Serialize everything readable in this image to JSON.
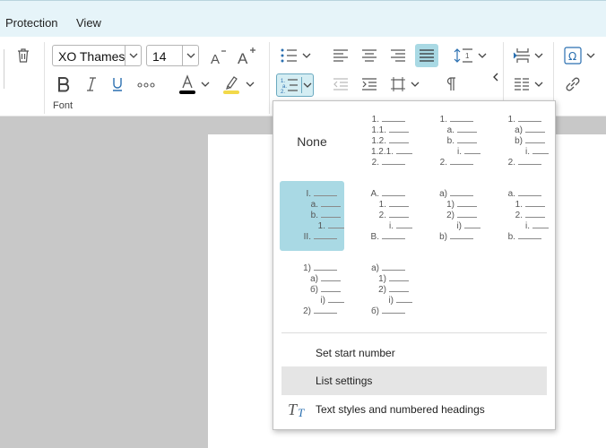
{
  "menubar": {
    "items": [
      "Protection",
      "View"
    ]
  },
  "ribbon": {
    "font_name": "XO Thames",
    "font_size": "14",
    "font_group_label": "Font",
    "font_color": "#000000",
    "highlight_color": "#f2d94a",
    "accent": "#a9d9e4"
  },
  "numbering_menu": {
    "none_label": "None",
    "presets": [
      {
        "levels": [
          {
            "label": "1.",
            "indent": 0
          },
          {
            "label": "1.1.",
            "indent": 1
          },
          {
            "label": "1.2.",
            "indent": 1
          },
          {
            "label": "1.2.1.",
            "indent": 2
          },
          {
            "label": "2.",
            "indent": 0
          }
        ]
      },
      {
        "levels": [
          {
            "label": "1.",
            "indent": 0
          },
          {
            "label": "a.",
            "indent": 1
          },
          {
            "label": "b.",
            "indent": 1
          },
          {
            "label": "i.",
            "indent": 2
          },
          {
            "label": "2.",
            "indent": 0
          }
        ]
      },
      {
        "levels": [
          {
            "label": "1.",
            "indent": 0
          },
          {
            "label": "a)",
            "indent": 1
          },
          {
            "label": "b)",
            "indent": 1
          },
          {
            "label": "i.",
            "indent": 2
          },
          {
            "label": "2.",
            "indent": 0
          }
        ]
      },
      {
        "selected": true,
        "levels": [
          {
            "label": "I.",
            "indent": 0
          },
          {
            "label": "a.",
            "indent": 1
          },
          {
            "label": "b.",
            "indent": 1
          },
          {
            "label": "1.",
            "indent": 2
          },
          {
            "label": "II.",
            "indent": 0
          }
        ]
      },
      {
        "levels": [
          {
            "label": "A.",
            "indent": 0
          },
          {
            "label": "1.",
            "indent": 1
          },
          {
            "label": "2.",
            "indent": 1
          },
          {
            "label": "i.",
            "indent": 2
          },
          {
            "label": "B.",
            "indent": 0
          }
        ]
      },
      {
        "levels": [
          {
            "label": "a)",
            "indent": 0
          },
          {
            "label": "1)",
            "indent": 1
          },
          {
            "label": "2)",
            "indent": 1
          },
          {
            "label": "i)",
            "indent": 2
          },
          {
            "label": "b)",
            "indent": 0
          }
        ]
      },
      {
        "levels": [
          {
            "label": "a.",
            "indent": 0
          },
          {
            "label": "1.",
            "indent": 1
          },
          {
            "label": "2.",
            "indent": 1
          },
          {
            "label": "i.",
            "indent": 2
          },
          {
            "label": "b.",
            "indent": 0
          }
        ]
      },
      {
        "levels": [
          {
            "label": "1)",
            "indent": 0
          },
          {
            "label": "a)",
            "indent": 1
          },
          {
            "label": "б)",
            "indent": 1
          },
          {
            "label": "i)",
            "indent": 2
          },
          {
            "label": "2)",
            "indent": 0
          }
        ]
      },
      {
        "levels": [
          {
            "label": "a)",
            "indent": 0
          },
          {
            "label": "1)",
            "indent": 1
          },
          {
            "label": "2)",
            "indent": 1
          },
          {
            "label": "i)",
            "indent": 2
          },
          {
            "label": "б)",
            "indent": 0
          }
        ]
      }
    ],
    "set_start_number": "Set start number",
    "list_settings": "List settings",
    "text_styles": "Text styles and numbered headings"
  }
}
